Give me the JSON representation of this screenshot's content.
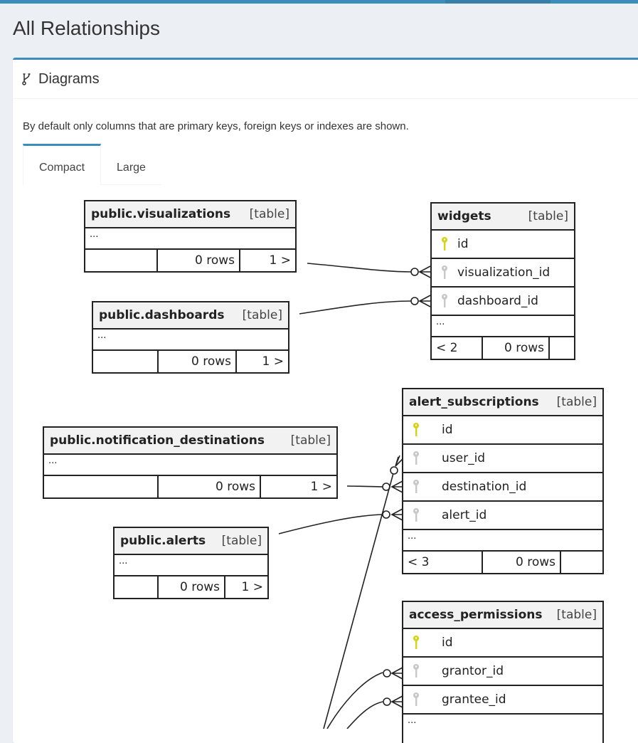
{
  "page": {
    "title": "All Relationships"
  },
  "box": {
    "icon": "code-fork-icon",
    "title": "Diagrams",
    "description": "By default only columns that are primary keys, foreign keys or indexes are shown."
  },
  "tabs": [
    {
      "label": "Compact",
      "active": true
    },
    {
      "label": "Large",
      "active": false
    }
  ],
  "diagram": {
    "tables": [
      {
        "id": "visualizations",
        "name": "public.visualizations",
        "kind": "[table]",
        "columns": [],
        "ellipsis": "...",
        "footer": {
          "left": "",
          "rows": "0 rows",
          "right": "1 >"
        }
      },
      {
        "id": "dashboards",
        "name": "public.dashboards",
        "kind": "[table]",
        "columns": [],
        "ellipsis": "...",
        "footer": {
          "left": "",
          "rows": "0 rows",
          "right": "1 >"
        }
      },
      {
        "id": "widgets",
        "name": "widgets",
        "kind": "[table]",
        "columns": [
          {
            "name": "id",
            "key": "primary"
          },
          {
            "name": "visualization_id",
            "key": "foreign"
          },
          {
            "name": "dashboard_id",
            "key": "foreign"
          }
        ],
        "ellipsis": "...",
        "footer": {
          "left": "< 2",
          "rows": "0 rows",
          "right": ""
        }
      },
      {
        "id": "notification_destinations",
        "name": "public.notification_destinations",
        "kind": "[table]",
        "columns": [],
        "ellipsis": "...",
        "footer": {
          "left": "",
          "rows": "0 rows",
          "right": "1 >"
        }
      },
      {
        "id": "alert_subscriptions",
        "name": "alert_subscriptions",
        "kind": "[table]",
        "columns": [
          {
            "name": "id",
            "key": "primary"
          },
          {
            "name": "user_id",
            "key": "foreign"
          },
          {
            "name": "destination_id",
            "key": "foreign"
          },
          {
            "name": "alert_id",
            "key": "foreign"
          }
        ],
        "ellipsis": "...",
        "footer": {
          "left": "< 3",
          "rows": "0 rows",
          "right": ""
        }
      },
      {
        "id": "alerts",
        "name": "public.alerts",
        "kind": "[table]",
        "columns": [],
        "ellipsis": "...",
        "footer": {
          "left": "",
          "rows": "0 rows",
          "right": "1 >"
        }
      },
      {
        "id": "access_permissions",
        "name": "access_permissions",
        "kind": "[table]",
        "columns": [
          {
            "name": "id",
            "key": "primary"
          },
          {
            "name": "grantor_id",
            "key": "foreign"
          },
          {
            "name": "grantee_id",
            "key": "foreign"
          }
        ],
        "ellipsis": "...",
        "footer": null
      }
    ],
    "relationships": [
      {
        "from": "visualizations",
        "to": "widgets.visualization_id",
        "cardinality": "zero-or-many"
      },
      {
        "from": "dashboards",
        "to": "widgets.dashboard_id",
        "cardinality": "zero-or-many"
      },
      {
        "from": "users",
        "to": "alert_subscriptions.user_id",
        "cardinality": "zero-or-many"
      },
      {
        "from": "notification_destinations",
        "to": "alert_subscriptions.destination_id",
        "cardinality": "zero-or-many"
      },
      {
        "from": "alerts",
        "to": "alert_subscriptions.alert_id",
        "cardinality": "zero-or-many"
      },
      {
        "from": "users",
        "to": "access_permissions.grantor_id",
        "cardinality": "zero-or-many"
      },
      {
        "from": "users",
        "to": "access_permissions.grantee_id",
        "cardinality": "zero-or-many"
      }
    ],
    "colors": {
      "primary_key": "#d4d417",
      "foreign_key": "#c8c8c8",
      "accent": "#3c8dbc"
    }
  }
}
